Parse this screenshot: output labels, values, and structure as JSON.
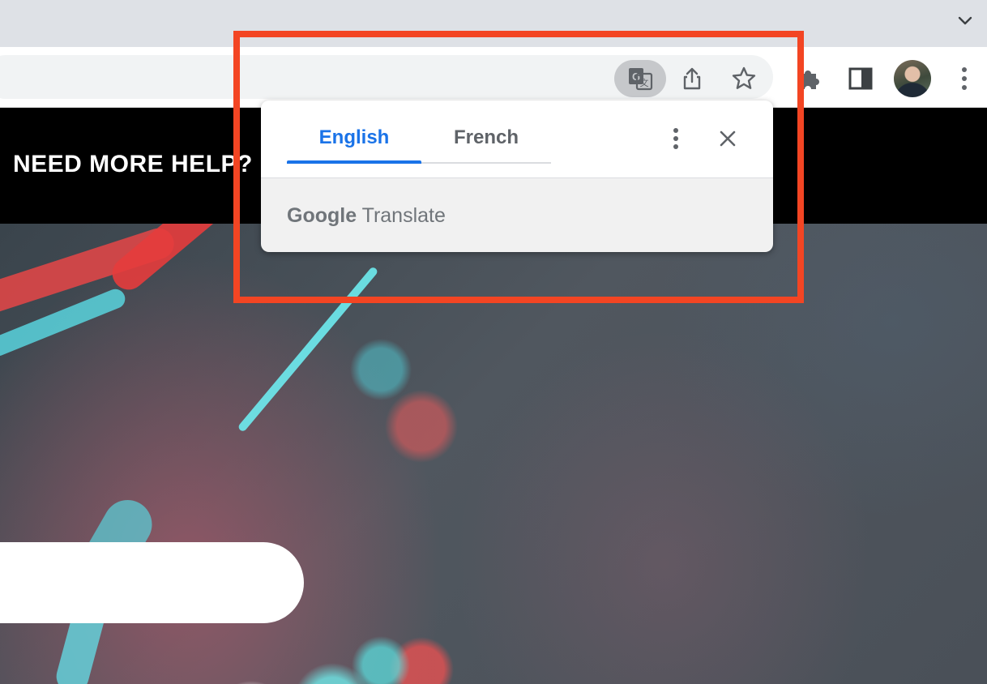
{
  "browser": {
    "tab_strip_icon": "chevron-down-icon",
    "toolbar_icons": [
      "translate-icon",
      "share-icon",
      "star-icon",
      "puzzle-icon",
      "side-panel-icon",
      "avatar",
      "kebab-menu-icon"
    ]
  },
  "page": {
    "banner_text": "NEED MORE HELP?"
  },
  "translate_popup": {
    "tabs": [
      {
        "label": "English",
        "selected": true
      },
      {
        "label": "French",
        "selected": false
      }
    ],
    "brand_google": "Google",
    "brand_translate": "Translate"
  },
  "colors": {
    "accent": "#1a73e8",
    "highlight_box": "#f34523"
  }
}
